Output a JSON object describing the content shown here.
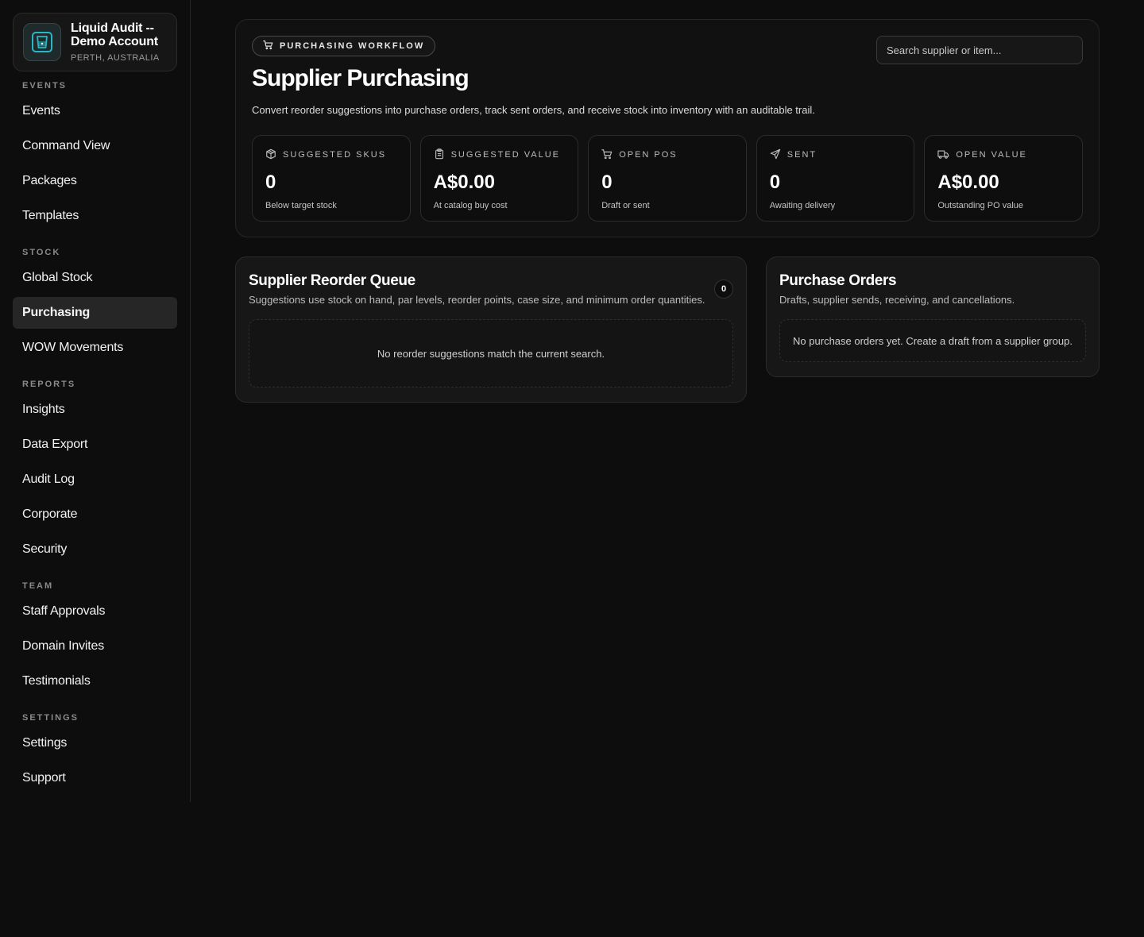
{
  "account": {
    "name": "Liquid Audit -- Demo Account",
    "location": "PERTH, AUSTRALIA",
    "logo_icon": "cup-icon",
    "accent": "#2bb6c4"
  },
  "nav": {
    "sections": [
      {
        "label": "EVENTS",
        "items": [
          "Events",
          "Command View",
          "Packages",
          "Templates"
        ]
      },
      {
        "label": "STOCK",
        "items": [
          "Global Stock",
          "Purchasing",
          "WOW Movements"
        ]
      },
      {
        "label": "REPORTS",
        "items": [
          "Insights",
          "Data Export",
          "Audit Log",
          "Corporate",
          "Security"
        ]
      },
      {
        "label": "TEAM",
        "items": [
          "Staff Approvals",
          "Domain Invites",
          "Testimonials"
        ]
      },
      {
        "label": "SETTINGS",
        "items": [
          "Settings",
          "Support"
        ]
      }
    ],
    "active": "Purchasing"
  },
  "hero": {
    "pill_label": "PURCHASING WORKFLOW",
    "title": "Supplier Purchasing",
    "description": "Convert reorder suggestions into purchase orders, track sent orders, and receive stock into inventory with an auditable trail.",
    "search_placeholder": "Search supplier or item..."
  },
  "stats": [
    {
      "icon": "package-icon",
      "label": "SUGGESTED SKUS",
      "value": "0",
      "sub": "Below target stock"
    },
    {
      "icon": "clipboard-icon",
      "label": "SUGGESTED VALUE",
      "value": "A$0.00",
      "sub": "At catalog buy cost"
    },
    {
      "icon": "cart-icon",
      "label": "OPEN POS",
      "value": "0",
      "sub": "Draft or sent"
    },
    {
      "icon": "send-icon",
      "label": "SENT",
      "value": "0",
      "sub": "Awaiting delivery"
    },
    {
      "icon": "truck-icon",
      "label": "OPEN VALUE",
      "value": "A$0.00",
      "sub": "Outstanding PO value"
    }
  ],
  "reorder_queue": {
    "title": "Supplier Reorder Queue",
    "description": "Suggestions use stock on hand, par levels, reorder points, case size, and minimum order quantities.",
    "count": "0",
    "empty_text": "No reorder suggestions match the current search."
  },
  "purchase_orders": {
    "title": "Purchase Orders",
    "description": "Drafts, supplier sends, receiving, and cancellations.",
    "empty_text": "No purchase orders yet. Create a draft from a supplier group."
  }
}
